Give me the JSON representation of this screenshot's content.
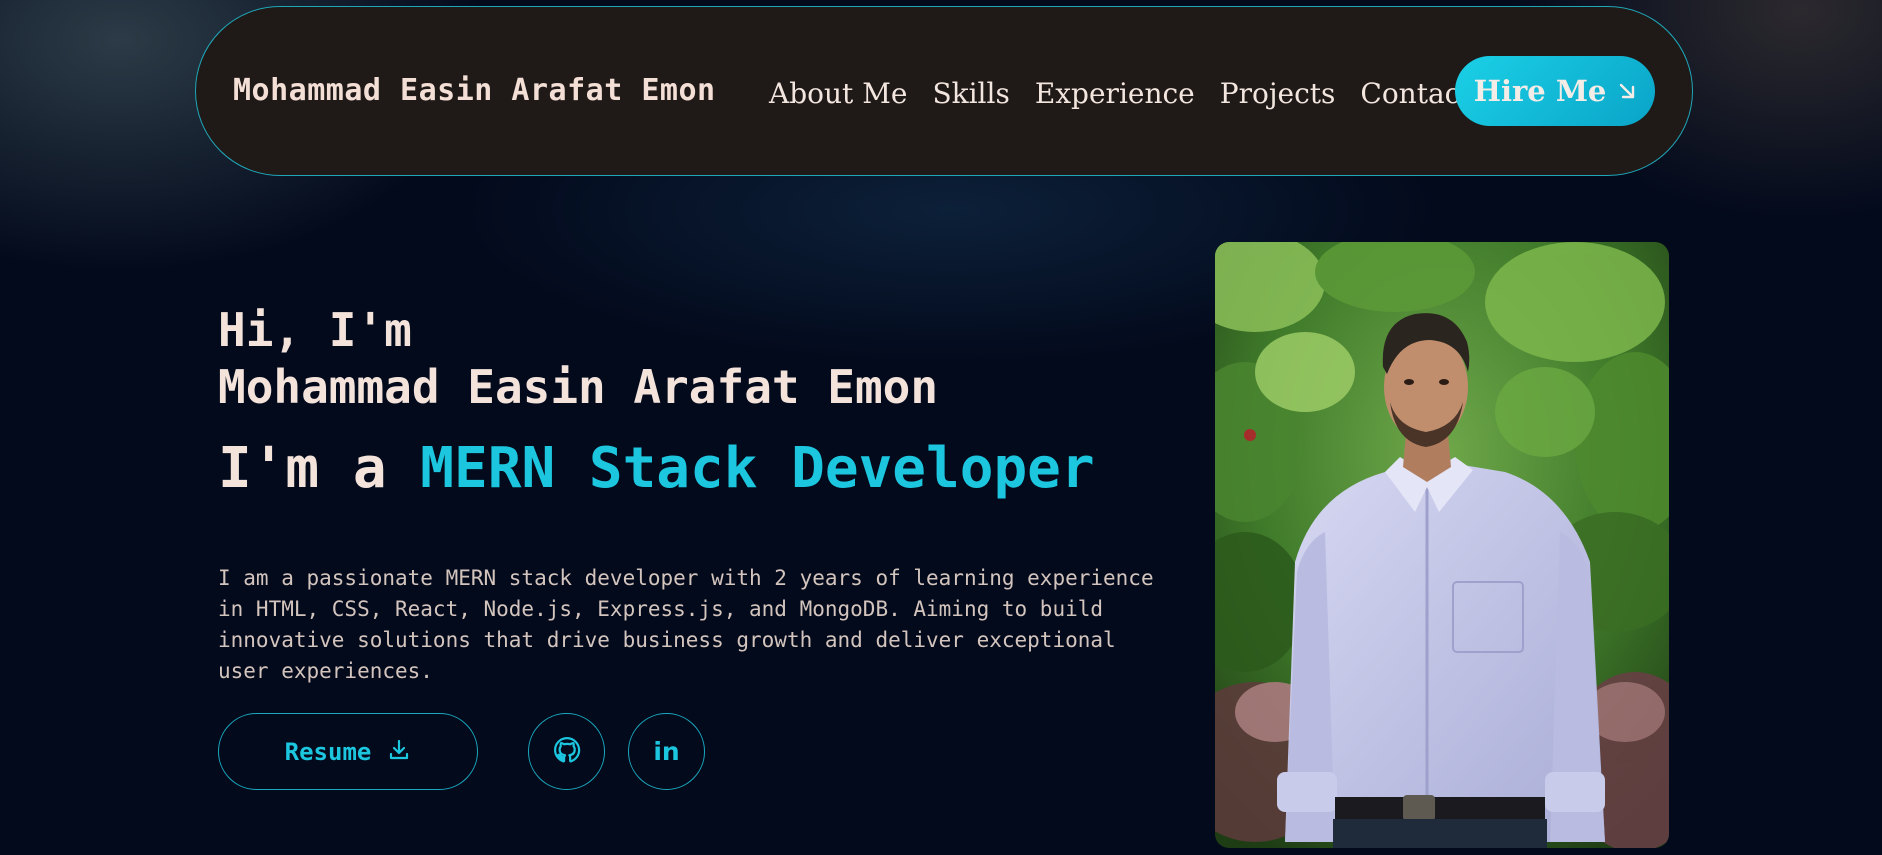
{
  "navbar": {
    "brand": "Mohammad Easin Arafat Emon",
    "links": [
      "About Me",
      "Skills",
      "Experience",
      "Projects",
      "Contact"
    ],
    "hire_label": "Hire Me",
    "hire_icon": "arrow-down-right-icon"
  },
  "hero": {
    "greeting_line1": "Hi, I'm",
    "greeting_line2": "Mohammad Easin Arafat Emon",
    "role_prefix": "I'm a ",
    "role_highlight": "MERN Stack Developer",
    "description": "I am a passionate MERN stack developer with 2 years of learning experience in HTML, CSS, React, Node.js, Express.js, and MongoDB. Aiming to build innovative solutions that drive business growth and deliver exceptional user experiences.",
    "resume_label": "Resume",
    "resume_icon": "download-icon",
    "github_icon": "github-icon",
    "linkedin_text": "in"
  },
  "colors": {
    "accent": "#1cc6df",
    "background": "#030a1c",
    "navbar_bg": "#1f1917",
    "text": "#f3e3db"
  }
}
